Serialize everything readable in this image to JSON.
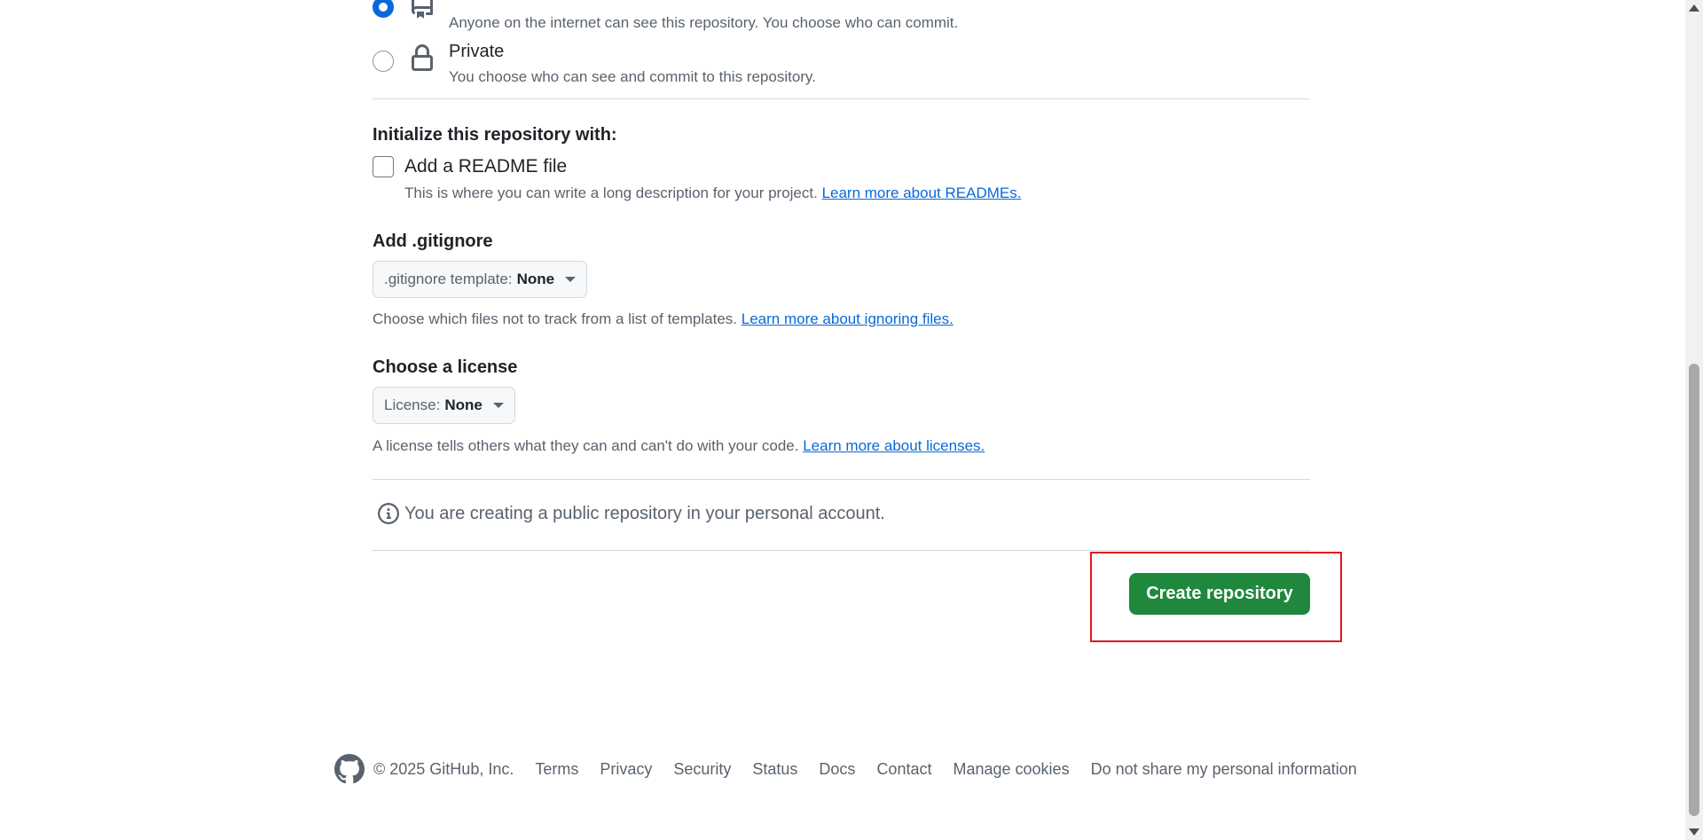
{
  "visibility": {
    "public": {
      "description": "Anyone on the internet can see this repository. You choose who can commit.",
      "checked": true
    },
    "private": {
      "label": "Private",
      "description": "You choose who can see and commit to this repository.",
      "checked": false
    }
  },
  "initialize": {
    "heading": "Initialize this repository with:",
    "readme_label": "Add a README file",
    "readme_help": "This is where you can write a long description for your project.",
    "readme_link": "Learn more about READMEs.",
    "readme_checked": false
  },
  "gitignore": {
    "heading": "Add .gitignore",
    "select_prefix": ".gitignore template:",
    "select_value": "None",
    "help": "Choose which files not to track from a list of templates.",
    "link": "Learn more about ignoring files."
  },
  "license": {
    "heading": "Choose a license",
    "select_prefix": "License:",
    "select_value": "None",
    "help": "A license tells others what they can and can't do with your code.",
    "link": "Learn more about licenses."
  },
  "notice": {
    "icon": "info-icon",
    "text": "You are creating a public repository in your personal account."
  },
  "create_button": "Create repository",
  "footer": {
    "logo": "github-logo-icon",
    "copyright": "© 2025 GitHub, Inc.",
    "links": [
      "Terms",
      "Privacy",
      "Security",
      "Status",
      "Docs",
      "Contact",
      "Manage cookies",
      "Do not share my personal information"
    ]
  },
  "colors": {
    "accent": "#0969da",
    "primary_button": "#1f883d",
    "highlight": "#e5161f"
  }
}
